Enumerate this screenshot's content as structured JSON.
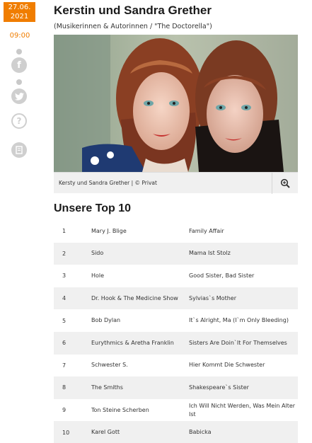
{
  "rail": {
    "date": "27.06.\n2021",
    "date_line1": "27.06.",
    "date_line2": "2021",
    "time": "09:00",
    "icons": [
      "facebook-icon",
      "twitter-icon",
      "help-icon",
      "print-icon"
    ]
  },
  "article": {
    "title": "Kerstin und Sandra Grether",
    "subtitle": "(Musikerinnen & Autorinnen / \"The Doctorella\")",
    "caption": "Kersty und Sandra Grether | © Privat",
    "list_heading": "Unsere Top 10"
  },
  "top10": [
    {
      "rank": "1",
      "artist": "Mary J. Blige",
      "song": "Family Affair"
    },
    {
      "rank": "2",
      "artist": "Sido",
      "song": "Mama Ist Stolz"
    },
    {
      "rank": "3",
      "artist": "Hole",
      "song": "Good Sister, Bad Sister"
    },
    {
      "rank": "4",
      "artist": "Dr. Hook & The Medicine Show",
      "song": "Sylvias`s Mother"
    },
    {
      "rank": "5",
      "artist": "Bob Dylan",
      "song": "It`s Alright, Ma (I`m Only Bleeding)"
    },
    {
      "rank": "6",
      "artist": "Eurythmics & Aretha Franklin",
      "song": "Sisters Are Doin`It For Themselves"
    },
    {
      "rank": "7",
      "artist": "Schwester S.",
      "song": "Hier Kommt Die Schwester"
    },
    {
      "rank": "8",
      "artist": "The Smiths",
      "song": "Shakespeare`s Sister"
    },
    {
      "rank": "9",
      "artist": "Ton Steine Scherben",
      "song": "Ich Will Nicht Werden, Was Mein Alter Ist"
    },
    {
      "rank": "10",
      "artist": "Karel Gott",
      "song": "Babicka"
    }
  ],
  "colors": {
    "accent": "#f07d00",
    "icon_gray": "#cfcfcf",
    "row_alt": "#f0f0f0"
  }
}
